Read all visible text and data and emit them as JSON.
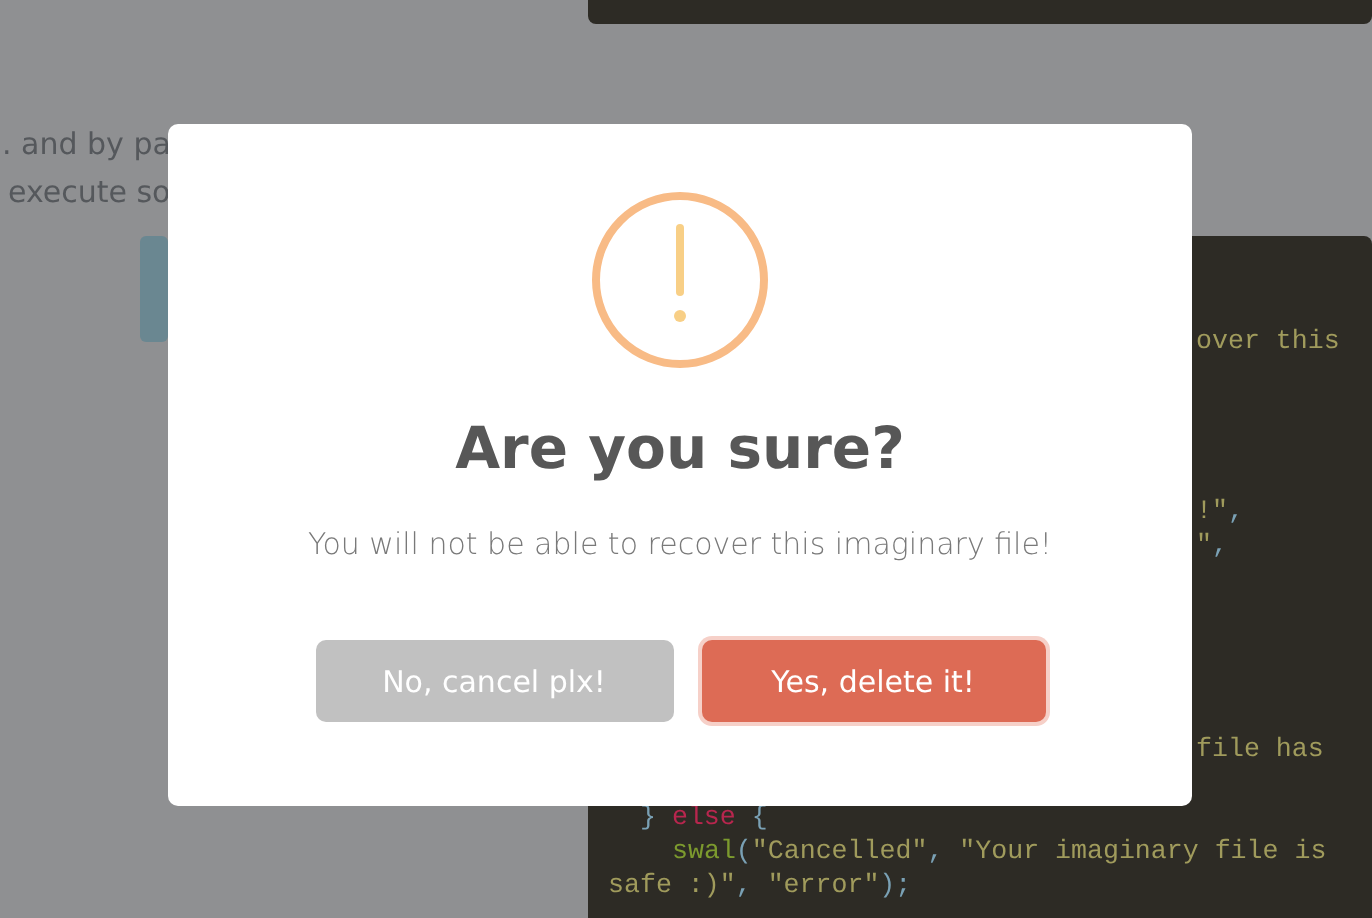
{
  "page": {
    "text_lines": [
      ". and by pa",
      "execute so"
    ]
  },
  "code_block": {
    "lines": [
      {
        "tokens": [
          {
            "text": "over this",
            "kind": "string"
          }
        ]
      },
      {
        "tokens": [
          {
            "text": "!\"",
            "kind": "string"
          },
          {
            "text": ",",
            "kind": "punct"
          }
        ]
      },
      {
        "tokens": [
          {
            "text": "\"",
            "kind": "string"
          },
          {
            "text": ",",
            "kind": "punct"
          }
        ]
      },
      {
        "tokens": [
          {
            "text": "file has",
            "kind": "string"
          }
        ]
      },
      {
        "tokens": [
          {
            "text": "} ",
            "kind": "punct"
          },
          {
            "text": "else",
            "kind": "keyword"
          },
          {
            "text": " {",
            "kind": "punct"
          }
        ]
      },
      {
        "tokens": [
          {
            "text": "swal",
            "kind": "function"
          },
          {
            "text": "(",
            "kind": "punct"
          },
          {
            "text": "\"Cancelled\"",
            "kind": "string"
          },
          {
            "text": ", ",
            "kind": "punct"
          },
          {
            "text": "\"Your imaginary file is",
            "kind": "string"
          }
        ]
      },
      {
        "tokens": [
          {
            "text": "safe :)\"",
            "kind": "string"
          },
          {
            "text": ", ",
            "kind": "punct"
          },
          {
            "text": "\"error\"",
            "kind": "string"
          },
          {
            "text": ");",
            "kind": "punct"
          }
        ]
      }
    ]
  },
  "dialog": {
    "title": "Are you sure?",
    "text": "You will not be able to recover this imaginary file!",
    "buttons": [
      {
        "label": "No, cancel plx!",
        "kind": "cancel"
      },
      {
        "label": "Yes, delete it!",
        "kind": "confirm"
      }
    ]
  }
}
